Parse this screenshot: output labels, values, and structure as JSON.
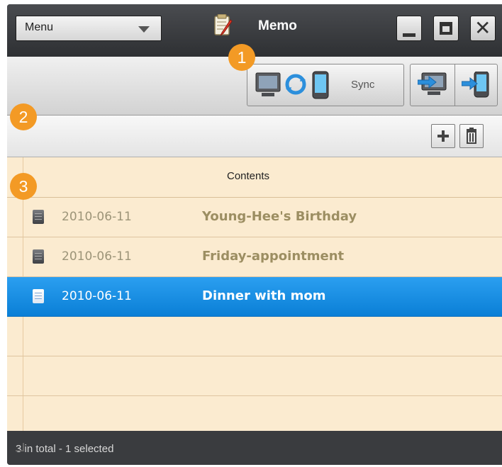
{
  "window": {
    "title": "Memo",
    "menu_label": "Menu",
    "controls": {
      "minimize": "minimize-icon",
      "maximize": "maximize-icon",
      "close": "close-icon"
    }
  },
  "toolbar": {
    "sync_label": "Sync",
    "icons": [
      "pc-monitor-icon",
      "sync-arrows-icon",
      "phone-icon",
      "pc-to-phone-transfer-icon",
      "phone-transfer-icon"
    ]
  },
  "subtoolbar": {
    "add_icon": "plus-icon",
    "delete_icon": "trash-icon"
  },
  "list": {
    "column_header": "Contents",
    "rows": [
      {
        "date": "2010-06-11",
        "title": "Young-Hee's Birthday",
        "selected": false
      },
      {
        "date": "2010-06-11",
        "title": "Friday-appointment",
        "selected": false
      },
      {
        "date": "2010-06-11",
        "title": "Dinner with mom",
        "selected": true
      }
    ]
  },
  "status": {
    "text": "3 in total - 1 selected"
  },
  "callouts": [
    "1",
    "2",
    "3"
  ],
  "colors": {
    "callout": "#f39a25",
    "selected_row": "#1a8fe6",
    "list_bg": "#fbebd0",
    "chrome": "#3a3c3f"
  }
}
